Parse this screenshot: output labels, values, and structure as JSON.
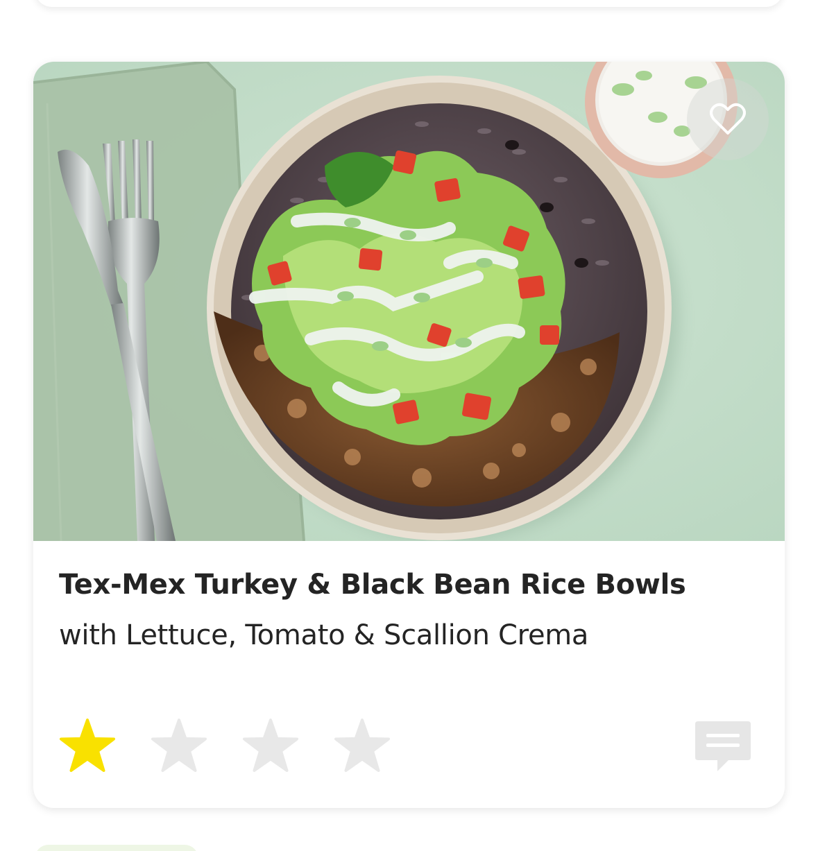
{
  "recipe": {
    "title": "Tex-Mex Turkey & Black Bean Rice Bowls",
    "subtitle": "with Lettuce, Tomato & Scallion Crema",
    "rating": {
      "value": 1,
      "max": 4
    }
  },
  "icons": {
    "favorite": "heart-icon",
    "star": "star-icon",
    "comment": "comment-icon"
  },
  "colors": {
    "star_filled": "#f9e100",
    "star_empty": "#e8e8e8",
    "comment_icon": "#e6e6e6",
    "background_green": "#c7dfcd"
  }
}
